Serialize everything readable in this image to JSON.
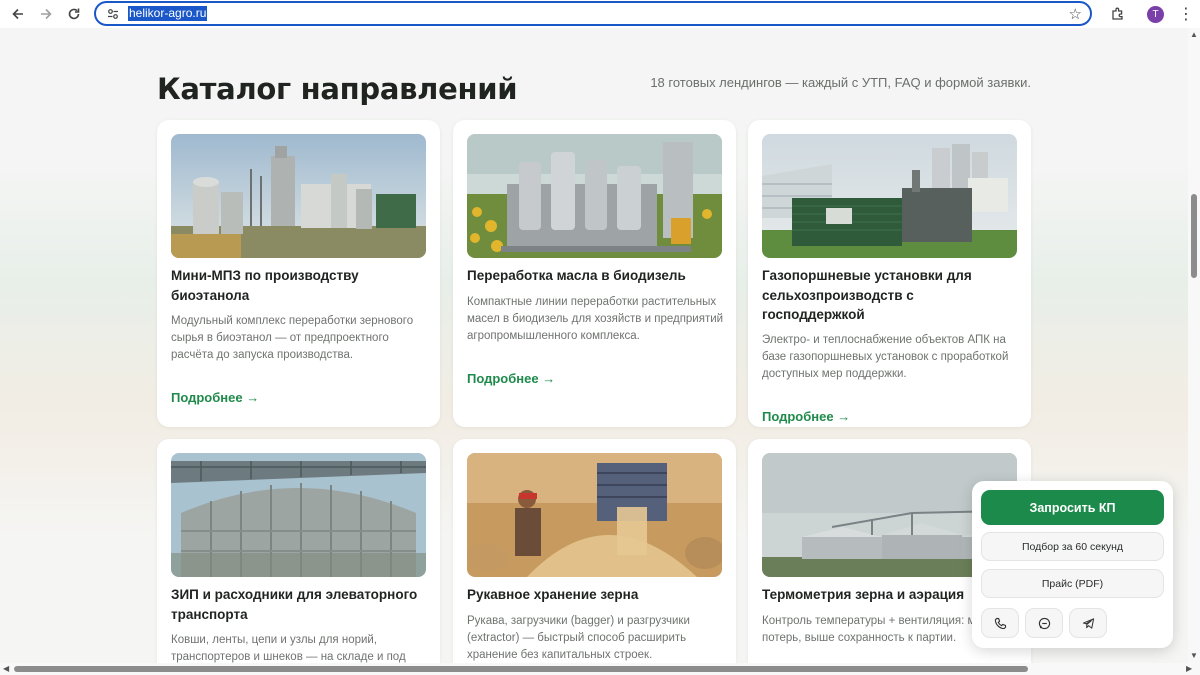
{
  "browser": {
    "url": "helikor-agro.ru",
    "profile_initial": "T"
  },
  "catalog": {
    "title": "Каталог направлений",
    "subtitle": "18 готовых лендингов — каждый с УТП, FAQ и формой заявки.",
    "cards": [
      {
        "title": "Мини-МПЗ по производству биоэтанола",
        "description": "Модульный комплекс переработки зернового сырья в биоэтанол — от предпроектного расчёта до запуска производства.",
        "link": "Подробнее →"
      },
      {
        "title": "Переработка масла в биодизель",
        "description": "Компактные линии переработки растительных масел в биодизель для хозяйств и предприятий агропромышленного комплекса.",
        "link": "Подробнее →"
      },
      {
        "title": "Газопоршневые установки для сельхозпроизводств с господдержкой",
        "description": "Электро- и теплоснабжение объектов АПК на базе газопоршневых установок с проработкой доступных мер поддержки.",
        "link": "Подробнее →"
      },
      {
        "title": "ЗИП и расходники для элеваторного транспорта",
        "description": "Ковши, ленты, цепи и узлы для норий, транспортеров и шнеков — на складе и под"
      },
      {
        "title": "Рукавное хранение зерна",
        "description": "Рукава, загрузчики (bagger) и разгрузчики (extractor) — быстрый способ расширить хранение без капитальных строек."
      },
      {
        "title": "Термометрия зерна и аэрация",
        "description": "Контроль температуры + вентиляция: меньше потерь, выше сохранность к партии."
      }
    ]
  },
  "float_panel": {
    "primary": "Запросить КП",
    "quick": "Подбор за 60 секунд",
    "price": "Прайс (PDF)",
    "icons": [
      "phone-icon",
      "chat-icon",
      "telegram-icon"
    ]
  },
  "colors": {
    "accent": "#1c8a4a",
    "link": "#1f8a4c",
    "url_highlight": "#1a57c8"
  }
}
